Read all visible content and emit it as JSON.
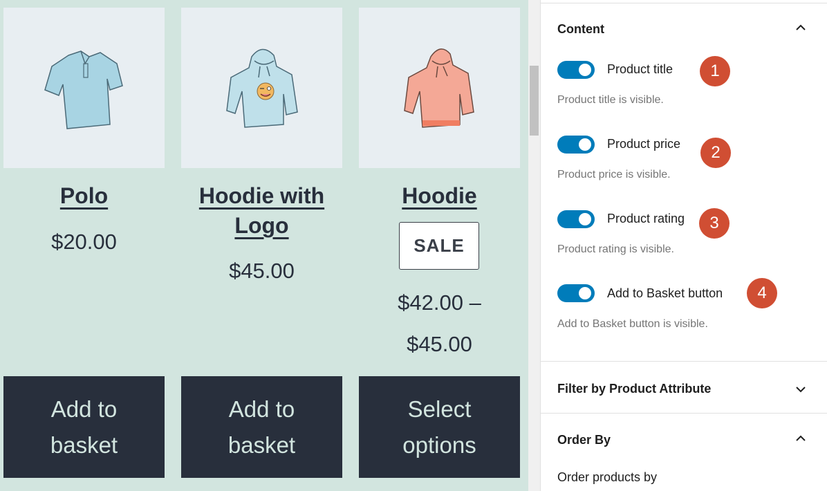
{
  "products": [
    {
      "name": "Polo",
      "title_lines": [
        "Polo"
      ],
      "image": "polo-shirt-image",
      "price": "$20.00",
      "sale_badge": null,
      "button": "Add to basket",
      "color": "#a8d4e3"
    },
    {
      "name": "Hoodie with Logo",
      "title_lines": [
        "Hoodie with",
        "Logo"
      ],
      "image": "hoodie-with-logo-image",
      "price": "$45.00",
      "sale_badge": null,
      "button": "Add to basket",
      "color": "#bfe0ea"
    },
    {
      "name": "Hoodie",
      "title_lines": [
        "Hoodie"
      ],
      "image": "hoodie-image",
      "price_lines": [
        "$42.00 –",
        "$45.00"
      ],
      "sale_badge": "SALE",
      "button": "Select options",
      "color": "#f4a896"
    }
  ],
  "inspector": {
    "content_panel": {
      "title": "Content",
      "expanded": true,
      "toggles": [
        {
          "label": "Product title",
          "help": "Product title is visible.",
          "enabled": true,
          "badge": "1"
        },
        {
          "label": "Product price",
          "help": "Product price is visible.",
          "enabled": true,
          "badge": "2"
        },
        {
          "label": "Product rating",
          "help": "Product rating is visible.",
          "enabled": true,
          "badge": "3"
        },
        {
          "label": "Add to Basket button",
          "help": "Add to Basket button is visible.",
          "enabled": true,
          "badge": "4"
        }
      ]
    },
    "filter_panel": {
      "title": "Filter by Product Attribute",
      "expanded": false
    },
    "order_panel": {
      "title": "Order By",
      "expanded": true,
      "field_label": "Order products by"
    }
  },
  "colors": {
    "canvas_bg": "#d2e5df",
    "button_bg": "#282f3c",
    "toggle_on": "#007cba",
    "badge": "#d04e33"
  }
}
